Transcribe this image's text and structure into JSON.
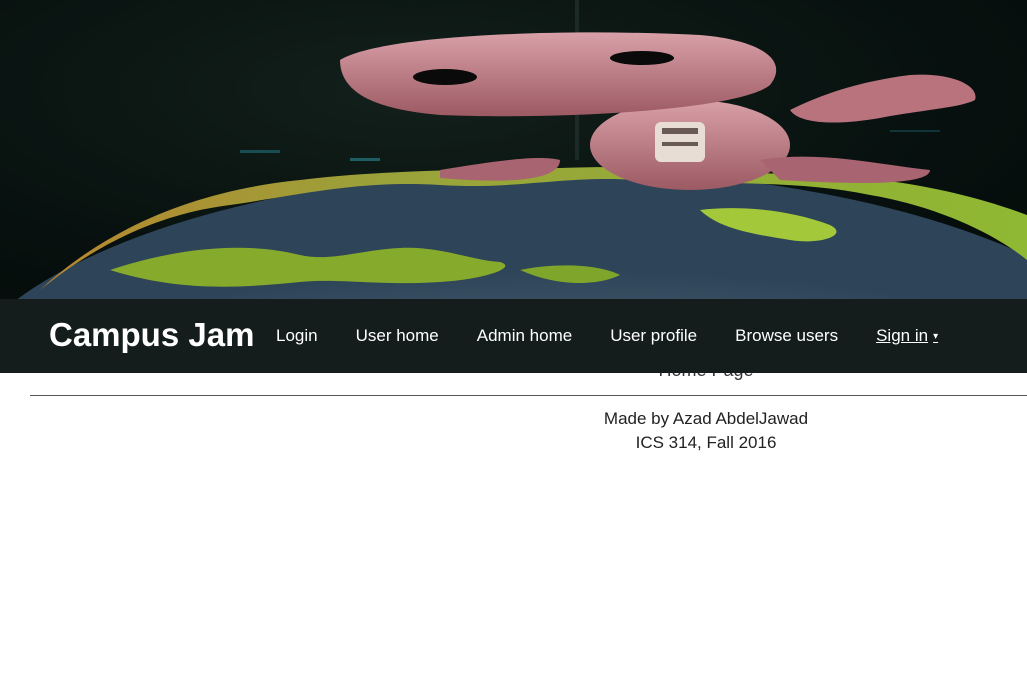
{
  "brand": {
    "title": "Campus Jam"
  },
  "nav": {
    "items": [
      {
        "label": "Login"
      },
      {
        "label": "User home"
      },
      {
        "label": "Admin home"
      },
      {
        "label": "User profile"
      },
      {
        "label": "Browse users"
      }
    ],
    "signin": {
      "label": "Sign in",
      "caret": "▾"
    }
  },
  "main": {
    "page_label": "Home Page"
  },
  "footer": {
    "line1": "Made by Azad AbdelJawad",
    "line2": "ICS 314, Fall 2016"
  },
  "hero": {
    "description_icon": "knitted-doll-on-globe-image"
  },
  "colors": {
    "navbar_bg": "#141d1b",
    "nav_text": "#ffffff",
    "page_bg": "#ffffff"
  }
}
